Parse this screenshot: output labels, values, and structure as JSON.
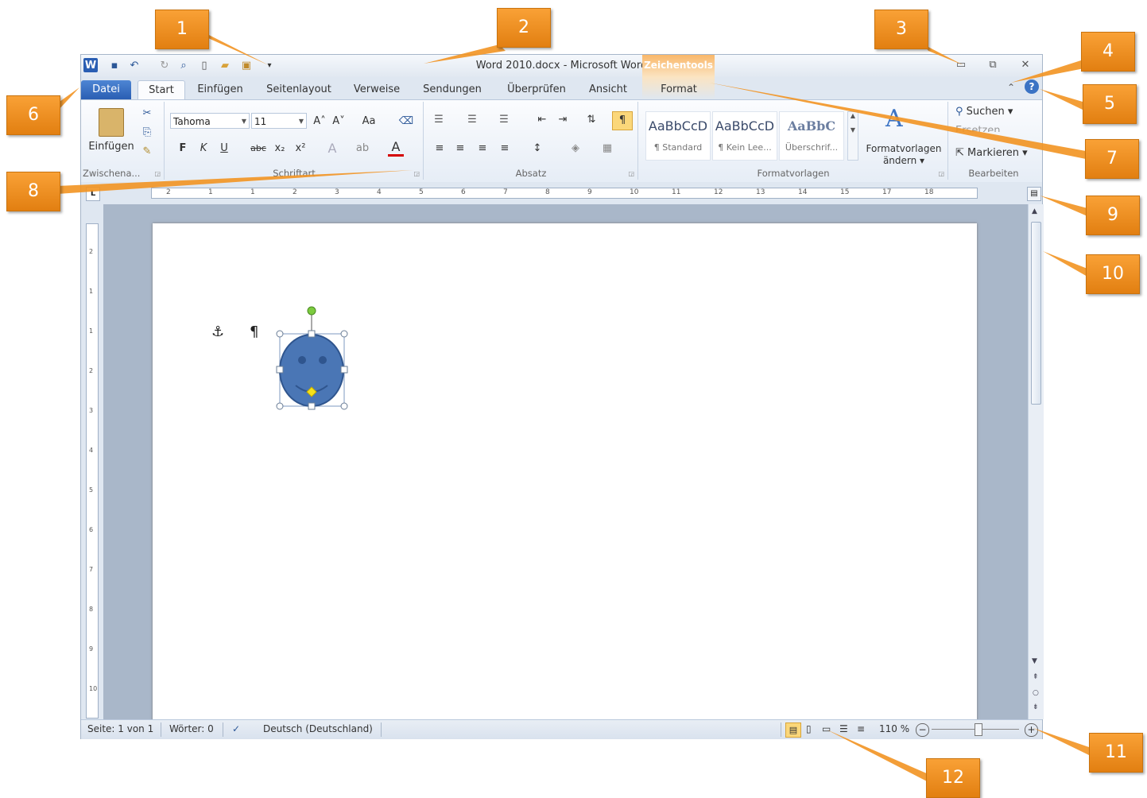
{
  "window": {
    "title": "Word 2010.docx - Microsoft Word",
    "contextual_group": "Zeichentools",
    "controls": {
      "minimize": "▭",
      "restore": "⧉",
      "close": "✕"
    }
  },
  "quick_access": {
    "app_icon": "W",
    "save_icon": "save-icon",
    "undo_icon": "undo-icon",
    "redo_icon": "redo-icon",
    "preview_icon": "print-preview-icon",
    "new_icon": "new-document-icon",
    "open_icon": "open-folder-icon",
    "extra_icon": "picture-icon",
    "customize": "▾"
  },
  "tabs": [
    "Datei",
    "Start",
    "Einfügen",
    "Seitenlayout",
    "Verweise",
    "Sendungen",
    "Überprüfen",
    "Ansicht",
    "Format"
  ],
  "ribbon": {
    "clipboard": {
      "paste_label": "Einfügen",
      "group_label": "Zwischena..."
    },
    "font": {
      "font_name": "Tahoma",
      "font_size": "11",
      "group_label": "Schriftart",
      "row1": [
        "A˄",
        "A˅",
        "Aa",
        "⌫"
      ],
      "row2": [
        "F",
        "K",
        "U",
        "abc",
        "x₂",
        "x²",
        "A",
        "ab",
        "A"
      ]
    },
    "paragraph": {
      "group_label": "Absatz",
      "pilcrow": "¶"
    },
    "styles": {
      "group_label": "Formatvorlagen",
      "tiles": [
        {
          "preview": "AaBbCcD",
          "name": "¶ Standard"
        },
        {
          "preview": "AaBbCcD",
          "name": "¶ Kein Lee..."
        },
        {
          "preview": "AaBbC",
          "name": "Überschrif..."
        }
      ],
      "change_label": "Formatvorlagen ändern ▾"
    },
    "editing": {
      "group_label": "Bearbeiten",
      "find": "Suchen ▾",
      "replace": "Ersetzen",
      "select": "Markieren ▾"
    }
  },
  "ruler": {
    "h_ticks": [
      "2",
      "1",
      "1",
      "2",
      "3",
      "4",
      "5",
      "6",
      "7",
      "8",
      "9",
      "10",
      "11",
      "12",
      "13",
      "14",
      "15",
      "17",
      "18"
    ],
    "v_ticks": [
      "2",
      "1",
      "1",
      "2",
      "3",
      "4",
      "5",
      "6",
      "7",
      "8",
      "9",
      "10"
    ]
  },
  "document": {
    "anchor": "⚓",
    "pilcrow": "¶",
    "shape": "smiley-shape"
  },
  "statusbar": {
    "page": "Seite: 1 von 1",
    "words": "Wörter: 0",
    "language": "Deutsch (Deutschland)",
    "zoom": "110 %",
    "zoom_minus": "−",
    "zoom_plus": "+"
  },
  "callouts": [
    "1",
    "2",
    "3",
    "4",
    "5",
    "6",
    "7",
    "8",
    "9",
    "10",
    "11",
    "12"
  ],
  "colors": {
    "accent": "#2a5eb3",
    "callout": "#f29422",
    "smiley": "#4a76b5"
  }
}
